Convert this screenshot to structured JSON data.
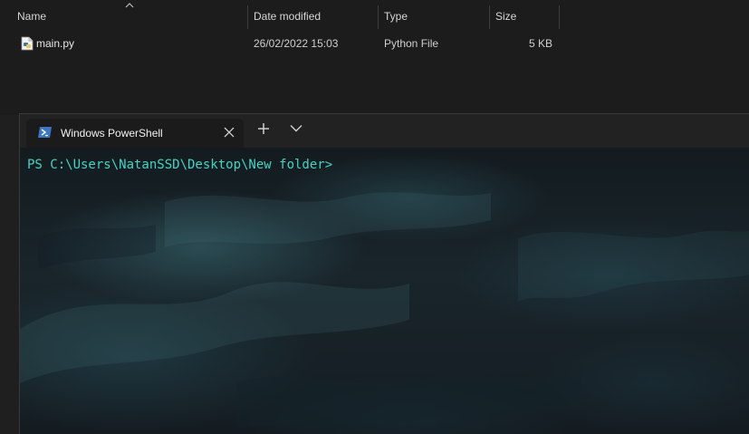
{
  "explorer": {
    "columns": {
      "name": "Name",
      "date": "Date modified",
      "type": "Type",
      "size": "Size"
    },
    "sort_column": "name",
    "files": [
      {
        "name": "main.py",
        "date": "26/02/2022 15:03",
        "type": "Python File",
        "size": "5 KB",
        "icon": "python-file-icon"
      }
    ]
  },
  "terminal": {
    "tab_title": "Windows PowerShell",
    "tab_icon": "powershell-icon",
    "prompt": "PS C:\\Users\\NatanSSD\\Desktop\\New folder>",
    "prompt_color": "#3fd6c6"
  },
  "colors": {
    "explorer_bg": "#1c1c1c",
    "tabbar_bg": "#222222",
    "tab_bg": "#1b1b1b"
  }
}
